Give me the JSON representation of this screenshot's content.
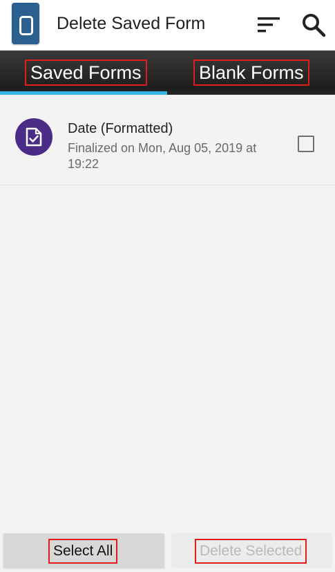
{
  "app": {
    "title": "Delete Saved Form",
    "logo_icon": "odk-collect-logo-icon",
    "actions": [
      {
        "icon": "sort-icon"
      },
      {
        "icon": "search-icon"
      }
    ]
  },
  "tabs": [
    {
      "label": "Saved Forms",
      "selected": true
    },
    {
      "label": "Blank Forms",
      "selected": false
    }
  ],
  "colors": {
    "tab_indicator": "#33b5e5",
    "avatar": "#4a2c86",
    "highlight_box": "#e21b1b"
  },
  "forms": [
    {
      "title": "Date (Formatted)",
      "subtitle": "Finalized on Mon, Aug 05, 2019 at 19:22",
      "icon": "finalized-form-icon",
      "checked": false
    }
  ],
  "buttons": {
    "select_all": "Select All",
    "delete_selected": "Delete Selected"
  }
}
